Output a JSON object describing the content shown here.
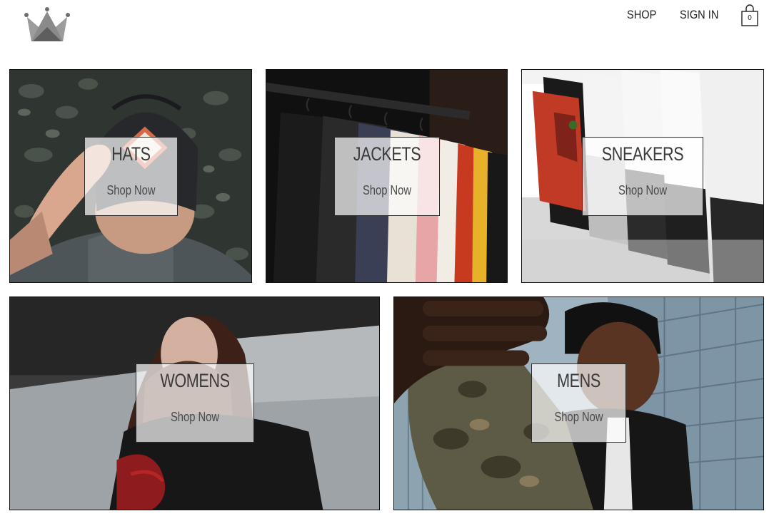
{
  "header": {
    "logo_icon": "crown-icon",
    "nav": {
      "shop_label": "SHOP",
      "signin_label": "SIGN IN"
    },
    "cart": {
      "icon": "shopping-bag-icon",
      "count": "0"
    }
  },
  "categories": [
    {
      "title": "HATS",
      "cta": "Shop Now",
      "image": "man-wearing-cap-photo"
    },
    {
      "title": "JACKETS",
      "cta": "Shop Now",
      "image": "jackets-on-rack-photo"
    },
    {
      "title": "SNEAKERS",
      "cta": "Shop Now",
      "image": "sneakers-row-photo"
    },
    {
      "title": "WOMENS",
      "cta": "Shop Now",
      "image": "woman-portrait-photo"
    },
    {
      "title": "MENS",
      "cta": "Shop Now",
      "image": "man-reaching-photo"
    }
  ],
  "colors": {
    "overlay_bg": "#ffffffb3",
    "text": "#3a3a3a",
    "border": "#111111"
  }
}
